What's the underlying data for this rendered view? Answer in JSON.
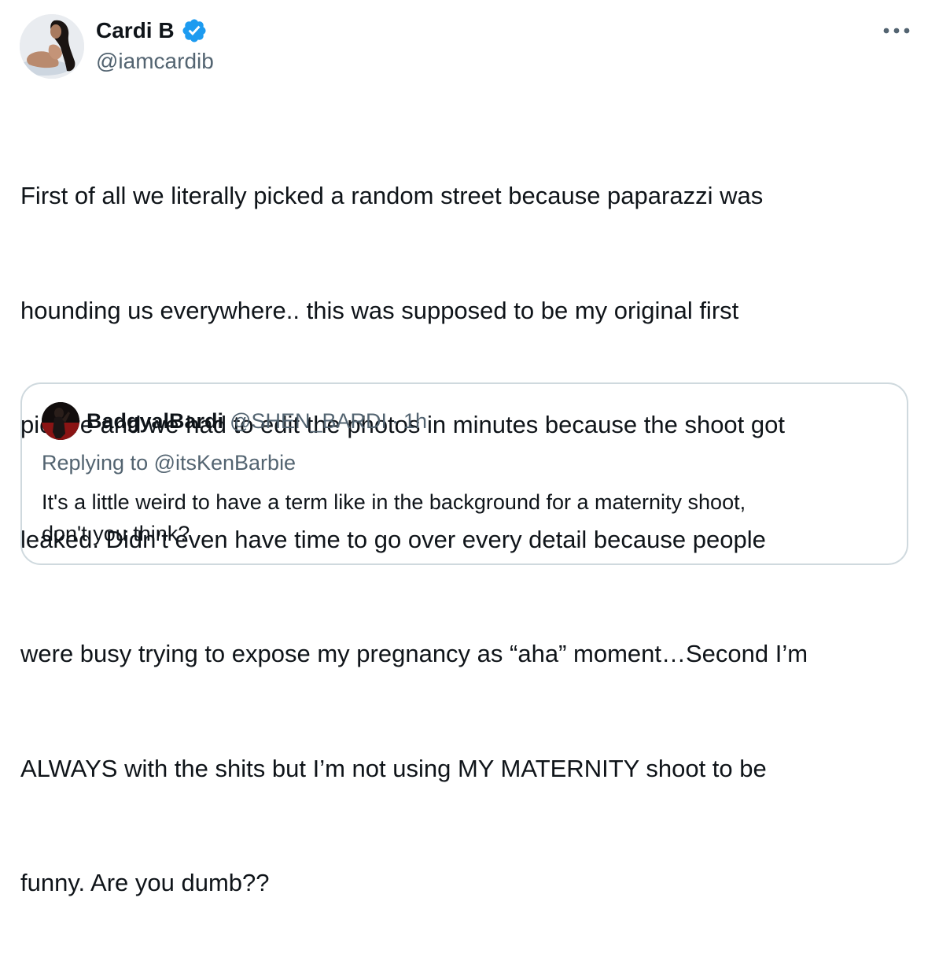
{
  "author": {
    "display_name": "Cardi B",
    "handle": "@iamcardib",
    "verified": true,
    "verified_color": "#1d9bf0"
  },
  "icons": {
    "avatar": "profile-photo",
    "verified": "verified-badge-icon",
    "more": "more-horizontal-icon"
  },
  "tweet": {
    "text_lines": [
      "First of all we literally picked a random street because paparazzi was",
      "hounding us everywhere.. this was supposed to be my original first",
      "picture and we had to edit the photos in minutes because the shoot got",
      "leaked. Didn’t even have time to go over every detail because people",
      "were busy trying to expose my pregnancy as “aha” moment…Second I’m",
      "ALWAYS with the shits but I’m not using MY MATERNITY shoot to be",
      "funny. Are you dumb??"
    ]
  },
  "quoted_tweet": {
    "display_name": "BadgyalBardi",
    "handle": "@SHEN_BARDI",
    "separator": "·",
    "time": "1h",
    "replying_to": "Replying to @itsKenBarbie",
    "text_lines": [
      "It's a little weird to have a term like in the background for a maternity shoot,",
      "don't you think?"
    ]
  },
  "colors": {
    "text_primary": "#0f1419",
    "text_secondary": "#536471",
    "border": "#cfd9de"
  }
}
